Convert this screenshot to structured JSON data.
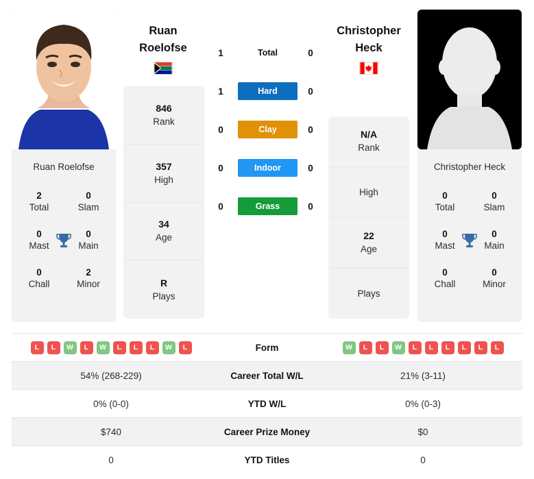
{
  "players": {
    "left": {
      "first_name": "Ruan",
      "last_name": "Roelofse",
      "full_name": "Ruan Roelofse",
      "country": "South Africa",
      "flag_icon": "flag-south-africa-icon",
      "photo_alt": "Ruan Roelofse photo",
      "stats": [
        {
          "value": "846",
          "label": "Rank"
        },
        {
          "value": "357",
          "label": "High"
        },
        {
          "value": "34",
          "label": "Age"
        },
        {
          "value": "R",
          "label": "Plays"
        }
      ],
      "trophies": [
        {
          "value": "2",
          "label": "Total"
        },
        {
          "value": "0",
          "label": "Slam"
        },
        {
          "value": "0",
          "label": "Mast"
        },
        {
          "value": "0",
          "label": "Main"
        },
        {
          "value": "0",
          "label": "Chall"
        },
        {
          "value": "2",
          "label": "Minor"
        }
      ],
      "form": [
        "L",
        "L",
        "W",
        "L",
        "W",
        "L",
        "L",
        "L",
        "W",
        "L"
      ]
    },
    "right": {
      "first_name": "Christopher",
      "last_name": "Heck",
      "full_name": "Christopher Heck",
      "country": "Canada",
      "flag_icon": "flag-canada-icon",
      "photo_alt": "Christopher Heck photo",
      "stats": [
        {
          "value": "N/A",
          "label": "Rank"
        },
        {
          "value": "",
          "label": "High"
        },
        {
          "value": "22",
          "label": "Age"
        },
        {
          "value": "",
          "label": "Plays"
        }
      ],
      "trophies": [
        {
          "value": "0",
          "label": "Total"
        },
        {
          "value": "0",
          "label": "Slam"
        },
        {
          "value": "0",
          "label": "Mast"
        },
        {
          "value": "0",
          "label": "Main"
        },
        {
          "value": "0",
          "label": "Chall"
        },
        {
          "value": "0",
          "label": "Minor"
        }
      ],
      "form": [
        "W",
        "L",
        "L",
        "W",
        "L",
        "L",
        "L",
        "L",
        "L",
        "L"
      ]
    }
  },
  "head_to_head": {
    "rows": [
      {
        "label": "Total",
        "left": "1",
        "right": "0",
        "color": "",
        "style": "plain"
      },
      {
        "label": "Hard",
        "left": "1",
        "right": "0",
        "color": "#0d6ebd",
        "style": "bar"
      },
      {
        "label": "Clay",
        "left": "0",
        "right": "0",
        "color": "#e09108",
        "style": "bar"
      },
      {
        "label": "Indoor",
        "left": "0",
        "right": "0",
        "color": "#2196f3",
        "style": "bar"
      },
      {
        "label": "Grass",
        "left": "0",
        "right": "0",
        "color": "#159b39",
        "style": "bar"
      }
    ]
  },
  "comparison_table": {
    "rows": [
      {
        "label": "Form",
        "type": "form",
        "left": "",
        "right": ""
      },
      {
        "label": "Career Total W/L",
        "type": "text",
        "left": "54% (268-229)",
        "right": "21% (3-11)"
      },
      {
        "label": "YTD W/L",
        "type": "text",
        "left": "0% (0-0)",
        "right": "0% (0-3)"
      },
      {
        "label": "Career Prize Money",
        "type": "text",
        "left": "$740",
        "right": "$0"
      },
      {
        "label": "YTD Titles",
        "type": "text",
        "left": "0",
        "right": "0"
      }
    ]
  },
  "theme": {
    "win_badge_color": "#ef5350",
    "loss_badge_color": "#81c784",
    "card_background": "#f2f2f2",
    "trophy_color": "#3b6ba5"
  }
}
